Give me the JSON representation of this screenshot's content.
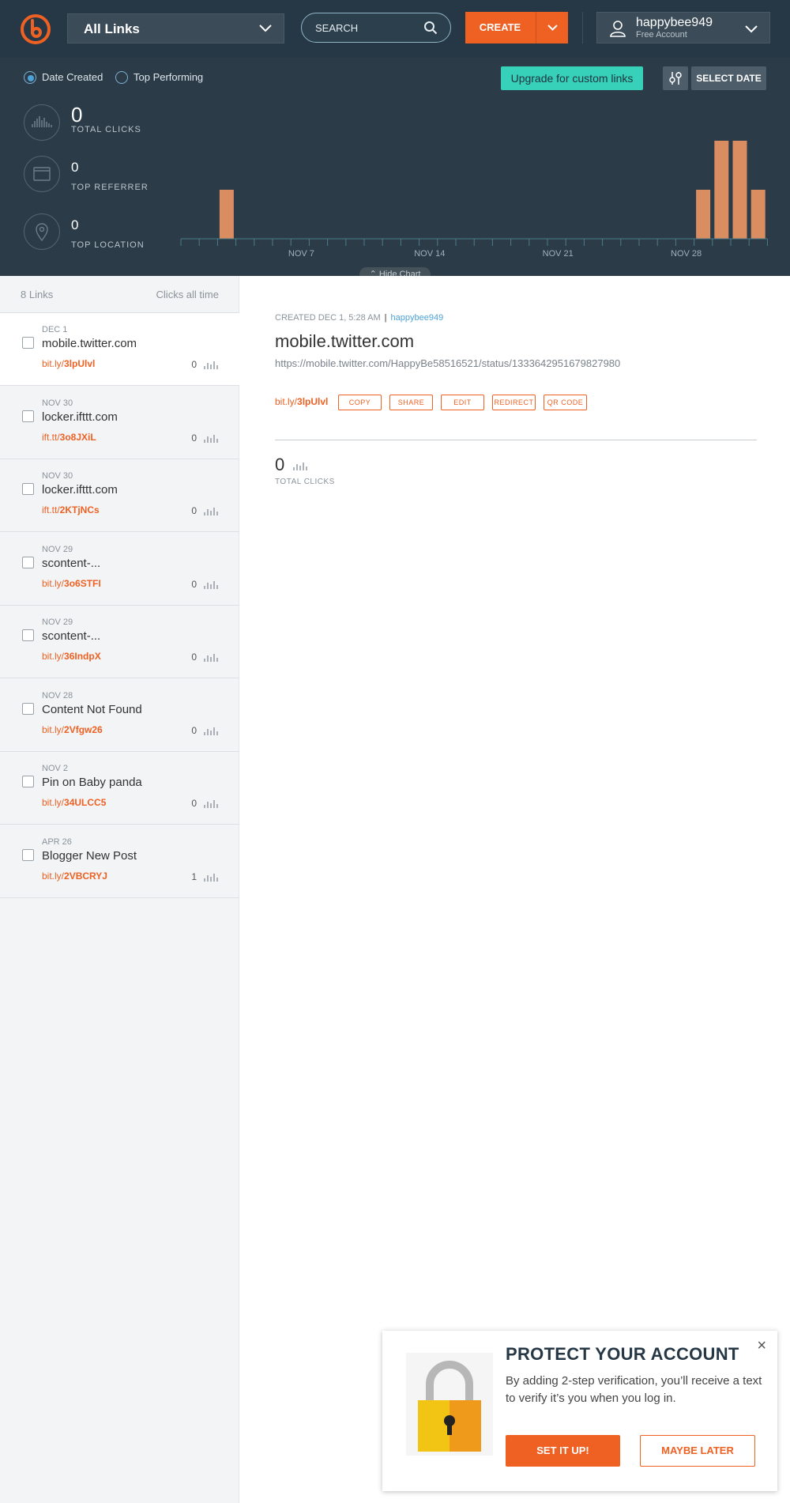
{
  "nav": {
    "links_dropdown": "All Links",
    "search_placeholder": "SEARCH",
    "create_label": "CREATE",
    "username": "happybee949",
    "plan": "Free Account"
  },
  "toolbar": {
    "sort_date": "Date Created",
    "sort_top": "Top Performing",
    "upgrade": "Upgrade for custom links",
    "select_date": "SELECT DATE"
  },
  "stats": {
    "total_clicks_value": "0",
    "total_clicks_label": "TOTAL CLICKS",
    "top_referrer_value": "0",
    "top_referrer_label": "TOP REFERRER",
    "top_location_value": "0",
    "top_location_label": "TOP LOCATION",
    "hide_chart": "Hide Chart"
  },
  "chart_data": {
    "type": "bar",
    "x_tick_labels": [
      "NOV 7",
      "NOV 14",
      "NOV 21",
      "NOV 28"
    ],
    "bars": [
      {
        "day_index": 2,
        "value": 0.5
      },
      {
        "day_index": 28,
        "value": 0.5
      },
      {
        "day_index": 29,
        "value": 1
      },
      {
        "day_index": 30,
        "value": 1
      },
      {
        "day_index": 31,
        "value": 0.5
      }
    ],
    "bar_color": "#d98d61"
  },
  "list": {
    "count": "8 Links",
    "clicks_header": "Clicks all time",
    "items": [
      {
        "date": "DEC 1",
        "title": "mobile.twitter.com",
        "domain": "bit.ly/",
        "hash": "3lpUlvl",
        "clicks": "0",
        "active": true
      },
      {
        "date": "NOV 30",
        "title": "locker.ifttt.com",
        "domain": "ift.tt/",
        "hash": "3o8JXiL",
        "clicks": "0"
      },
      {
        "date": "NOV 30",
        "title": "locker.ifttt.com",
        "domain": "ift.tt/",
        "hash": "2KTjNCs",
        "clicks": "0"
      },
      {
        "date": "NOV 29",
        "title": "scontent-...",
        "domain": "bit.ly/",
        "hash": "3o6STFI",
        "clicks": "0"
      },
      {
        "date": "NOV 29",
        "title": "scontent-...",
        "domain": "bit.ly/",
        "hash": "36IndpX",
        "clicks": "0"
      },
      {
        "date": "NOV 28",
        "title": "Content Not Found",
        "domain": "bit.ly/",
        "hash": "2Vfgw26",
        "clicks": "0"
      },
      {
        "date": "NOV 2",
        "title": "Pin on Baby panda",
        "domain": "bit.ly/",
        "hash": "34ULCC5",
        "clicks": "0"
      },
      {
        "date": "APR 26",
        "title": "Blogger New Post",
        "domain": "bit.ly/",
        "hash": "2VBCRYJ",
        "clicks": "1"
      }
    ]
  },
  "detail": {
    "created": "CREATED DEC 1, 5:28 AM",
    "separator": "|",
    "user": "happybee949",
    "title": "mobile.twitter.com",
    "long_url": "https://mobile.twitter.com/HappyBe58516521/status/1333642951679827980",
    "short_domain": "bit.ly/",
    "short_hash": "3lpUlvl",
    "actions": [
      "COPY",
      "SHARE",
      "EDIT",
      "REDIRECT",
      "QR CODE"
    ],
    "clicks": "0",
    "clicks_label": "TOTAL CLICKS"
  },
  "modal": {
    "title": "PROTECT YOUR ACCOUNT",
    "text": "By adding 2-step verification, you’ll receive a text to verify it’s you when you log in.",
    "primary": "SET IT UP!",
    "secondary": "MAYBE LATER",
    "close": "×"
  },
  "colors": {
    "accent": "#ee6123",
    "nav_bg": "#263845",
    "panel_bg": "#2b3c48",
    "teal": "#36d1b8"
  }
}
